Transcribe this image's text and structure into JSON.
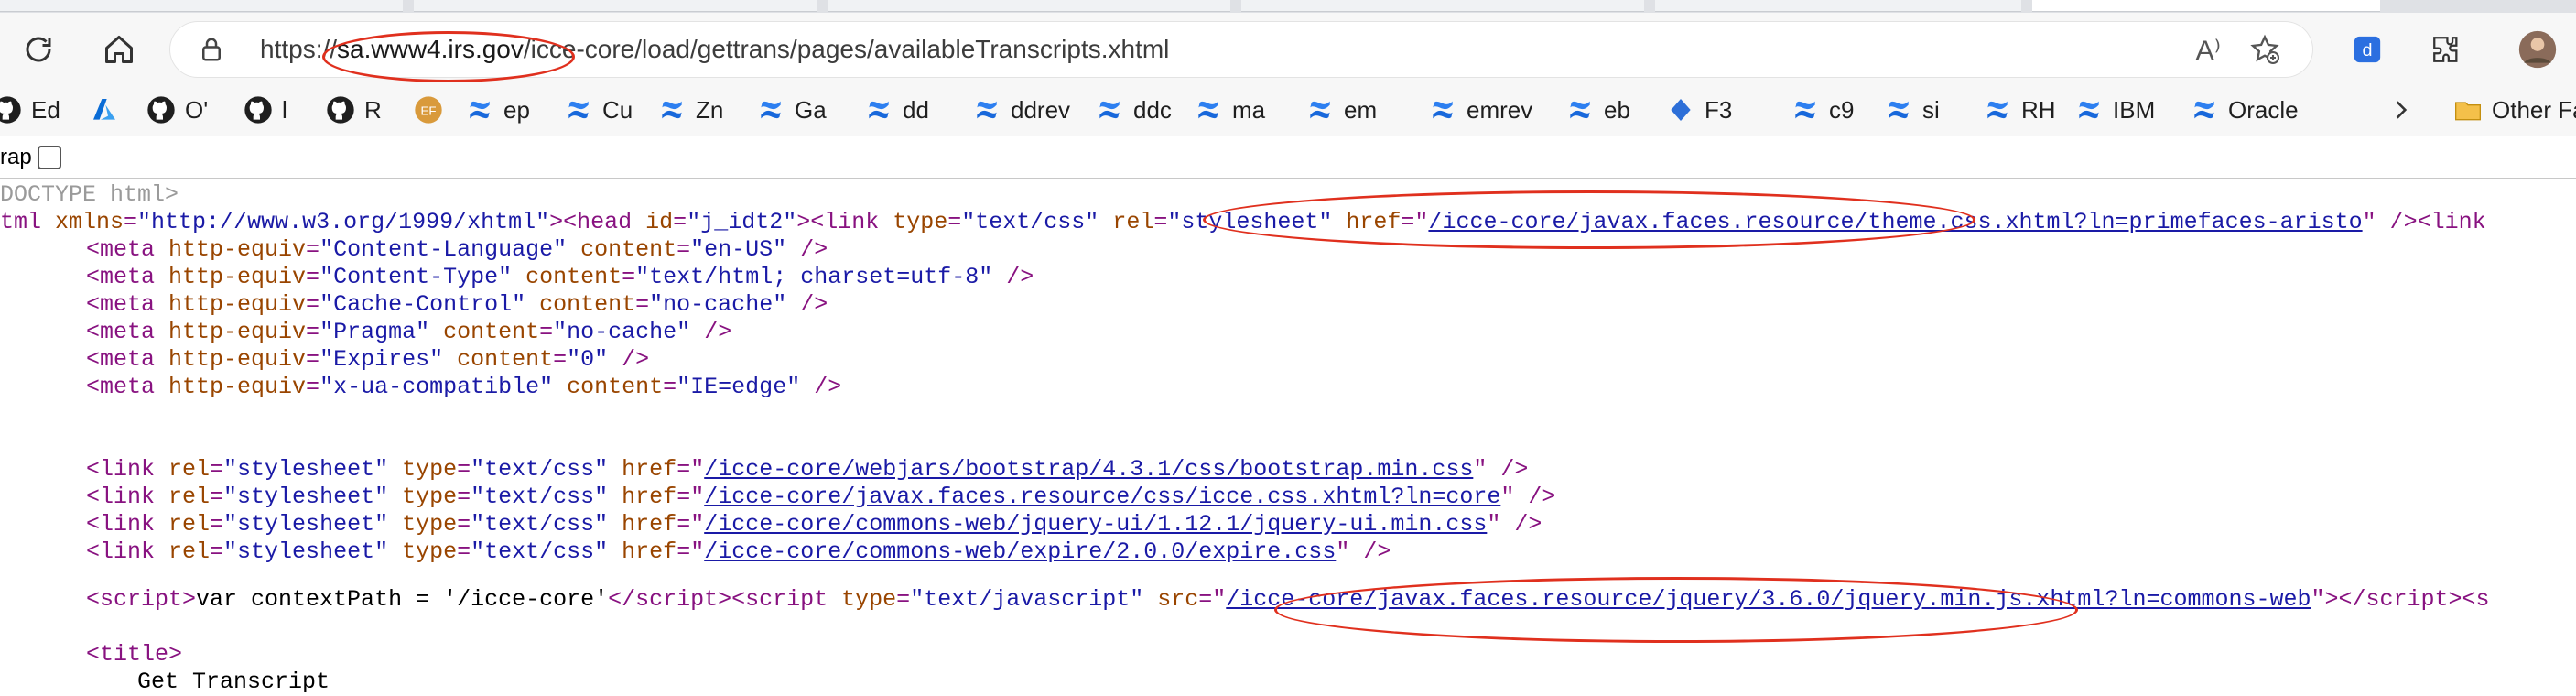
{
  "browser": {
    "url_prefix": "https://",
    "url_host": "sa.www4.irs.gov",
    "url_path": "/icce-core/load/gettrans/pages/availableTranscripts.xhtml",
    "readaloud_icon": "A⁾"
  },
  "bookmarks": [
    {
      "label": "Ed",
      "icon": "github-icon"
    },
    {
      "label": "",
      "icon": "azure-icon"
    },
    {
      "label": "O'",
      "icon": "github-icon"
    },
    {
      "label": "l",
      "icon": "github-icon"
    },
    {
      "label": "R",
      "icon": "github-icon"
    },
    {
      "label": "",
      "icon": "ef-icon"
    },
    {
      "label": "ep",
      "icon": "confluence-icon"
    },
    {
      "label": "Cu",
      "icon": "confluence-icon"
    },
    {
      "label": "Zn",
      "icon": "confluence-icon"
    },
    {
      "label": "Ga",
      "icon": "confluence-icon"
    },
    {
      "label": "dd",
      "icon": "confluence-icon"
    },
    {
      "label": "ddrev",
      "icon": "confluence-icon"
    },
    {
      "label": "ddc",
      "icon": "confluence-icon"
    },
    {
      "label": "ma",
      "icon": "confluence-icon"
    },
    {
      "label": "em",
      "icon": "confluence-icon"
    },
    {
      "label": "emrev",
      "icon": "confluence-icon"
    },
    {
      "label": "eb",
      "icon": "confluence-icon"
    },
    {
      "label": "F3",
      "icon": "diamond-icon"
    },
    {
      "label": "c9",
      "icon": "confluence-icon"
    },
    {
      "label": "si",
      "icon": "confluence-icon"
    },
    {
      "label": "RH",
      "icon": "confluence-icon"
    },
    {
      "label": "IBM",
      "icon": "confluence-icon"
    },
    {
      "label": "Oracle",
      "icon": "confluence-icon"
    },
    {
      "label": "Other Fa",
      "icon": "folder-icon"
    }
  ],
  "ef_badge": "EF",
  "page": {
    "wrap_label": "rap",
    "source": {
      "doctype": "DOCTYPE html>",
      "html_open": "tml xmlns=\"http://www.w3.org/1999/xhtml\"><head id=\"j_idt2\"><link type=\"text/css\" rel=\"stylesheet\" href=\"",
      "theme_href": "/icce-core/javax.faces.resource/theme.css.xhtml?ln=primefaces-aristo",
      "html_open_tail": "\" /><link",
      "meta": [
        {
          "equiv": "Content-Language",
          "content": "en-US"
        },
        {
          "equiv": "Content-Type",
          "content": "text/html; charset=utf-8"
        },
        {
          "equiv": "Cache-Control",
          "content": "no-cache"
        },
        {
          "equiv": "Pragma",
          "content": "no-cache"
        },
        {
          "equiv": "Expires",
          "content": "0"
        },
        {
          "equiv": "x-ua-compatible",
          "content": "IE=edge"
        }
      ],
      "links": [
        {
          "href": "/icce-core/webjars/bootstrap/4.3.1/css/bootstrap.min.css"
        },
        {
          "href": "/icce-core/javax.faces.resource/css/icce.css.xhtml?ln=core"
        },
        {
          "href": "/icce-core/commons-web/jquery-ui/1.12.1/jquery-ui.min.css"
        },
        {
          "href": "/icce-core/commons-web/expire/2.0.0/expire.css"
        }
      ],
      "script_inline": "var contextPath = '/icce-core'",
      "script_src": "/icce-core/javax.faces.resource/jquery/3.6.0/jquery.min.js.xhtml?ln=commons-web",
      "title_open": "<title>",
      "title_text": "Get Transcript"
    }
  },
  "colors": {
    "tag": "#881280",
    "attr": "#994500",
    "value": "#1a1aa6",
    "highlight": "#e0301e",
    "confluence_blue": "#1868db"
  }
}
